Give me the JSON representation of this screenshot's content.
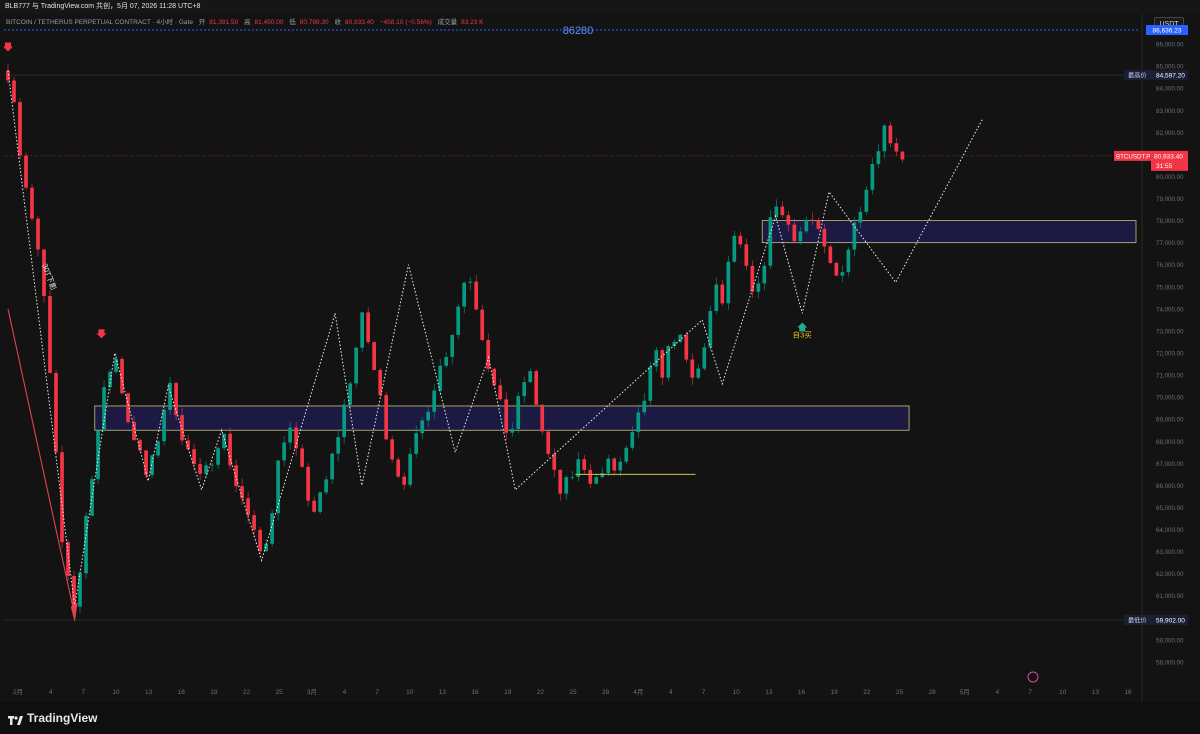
{
  "topbar": {
    "text": "BLB777 与 TradingView.com 共创，5月 07, 2026 11:28 UTC+8"
  },
  "legend": {
    "symbol": "BITCOIN / TETHERUS PERPETUAL CONTRACT · 4小时 · Gate",
    "open_label": "开",
    "open": "81,391.50",
    "high_label": "高",
    "high": "81,450.00",
    "low_label": "低",
    "low": "80,798.30",
    "close_label": "收",
    "close": "80,933.40",
    "change": "−458.10 (−0.56%)",
    "volume_label": "成交量",
    "volume": "83.23 K"
  },
  "currency_button": "USDT",
  "brand": "TradingView",
  "chart_data": {
    "type": "candlestick",
    "symbol": "BTCUSDT.P",
    "timeframe": "4h",
    "ylim": [
      57000,
      87000
    ],
    "y_ticks": [
      58000,
      59000,
      60000,
      61000,
      62000,
      63000,
      64000,
      65000,
      66000,
      67000,
      68000,
      69000,
      70000,
      71000,
      72000,
      73000,
      74000,
      75000,
      76000,
      77000,
      78000,
      79000,
      80000,
      81000,
      82000,
      83000,
      84000,
      85000,
      86000
    ],
    "x_ticks": [
      "2月",
      "4",
      "7",
      "10",
      "13",
      "16",
      "19",
      "22",
      "25",
      "3月",
      "4",
      "7",
      "10",
      "13",
      "16",
      "19",
      "22",
      "25",
      "28",
      "4月",
      "4",
      "7",
      "10",
      "13",
      "16",
      "19",
      "22",
      "25",
      "28",
      "5月",
      "4",
      "7",
      "10",
      "13",
      "16"
    ],
    "price_path": [
      [
        0,
        84800
      ],
      [
        1,
        83500
      ],
      [
        2,
        80500
      ],
      [
        3,
        79000
      ],
      [
        4,
        77000
      ],
      [
        5,
        76000
      ],
      [
        6,
        72000
      ],
      [
        7,
        68000
      ],
      [
        8,
        63500
      ],
      [
        9,
        62000
      ],
      [
        10,
        60500
      ],
      [
        11,
        62500
      ],
      [
        12,
        65500
      ],
      [
        13,
        67500
      ],
      [
        14,
        69500
      ],
      [
        15,
        71000
      ],
      [
        16,
        72000
      ],
      [
        17,
        70500
      ],
      [
        18,
        69000
      ],
      [
        19,
        68200
      ],
      [
        20,
        67000
      ],
      [
        21,
        66200
      ],
      [
        22,
        67500
      ],
      [
        23,
        69000
      ],
      [
        24,
        70500
      ],
      [
        25,
        69800
      ],
      [
        26,
        68500
      ],
      [
        27,
        67500
      ],
      [
        28,
        66800
      ],
      [
        29,
        66000
      ],
      [
        30,
        66800
      ],
      [
        31,
        67800
      ],
      [
        32,
        68500
      ],
      [
        33,
        67500
      ],
      [
        34,
        66200
      ],
      [
        35,
        65500
      ],
      [
        36,
        64500
      ],
      [
        37,
        63500
      ],
      [
        38,
        62800
      ],
      [
        39,
        64000
      ],
      [
        40,
        66000
      ],
      [
        41,
        68000
      ],
      [
        42,
        68800
      ],
      [
        43,
        67500
      ],
      [
        44,
        66500
      ],
      [
        45,
        65500
      ],
      [
        46,
        64800
      ],
      [
        47,
        65500
      ],
      [
        48,
        66500
      ],
      [
        49,
        67800
      ],
      [
        50,
        69000
      ],
      [
        51,
        70500
      ],
      [
        52,
        72000
      ],
      [
        53,
        73500
      ],
      [
        54,
        72500
      ],
      [
        55,
        71000
      ],
      [
        56,
        69500
      ],
      [
        57,
        68000
      ],
      [
        58,
        67000
      ],
      [
        59,
        66200
      ],
      [
        60,
        66800
      ],
      [
        61,
        67800
      ],
      [
        62,
        68800
      ],
      [
        63,
        69800
      ],
      [
        64,
        70800
      ],
      [
        65,
        71500
      ],
      [
        66,
        72500
      ],
      [
        67,
        73500
      ],
      [
        68,
        75000
      ],
      [
        69,
        75800
      ],
      [
        70,
        74500
      ],
      [
        71,
        73000
      ],
      [
        72,
        71500
      ],
      [
        73,
        70200
      ],
      [
        74,
        69200
      ],
      [
        75,
        68200
      ],
      [
        76,
        69000
      ],
      [
        77,
        70500
      ],
      [
        78,
        71200
      ],
      [
        79,
        70000
      ],
      [
        80,
        68500
      ],
      [
        81,
        67200
      ],
      [
        82,
        66200
      ],
      [
        83,
        65500
      ],
      [
        84,
        66200
      ],
      [
        85,
        66800
      ],
      [
        86,
        67200
      ],
      [
        87,
        66500
      ],
      [
        88,
        66200
      ],
      [
        89,
        66600
      ],
      [
        90,
        66900
      ],
      [
        91,
        66700
      ],
      [
        92,
        67100
      ],
      [
        93,
        67600
      ],
      [
        94,
        68500
      ],
      [
        95,
        69500
      ],
      [
        96,
        70800
      ],
      [
        97,
        71800
      ],
      [
        98,
        71200
      ],
      [
        99,
        72100
      ],
      [
        100,
        73000
      ],
      [
        101,
        72200
      ],
      [
        102,
        71000
      ],
      [
        103,
        70600
      ],
      [
        104,
        72000
      ],
      [
        105,
        73500
      ],
      [
        106,
        74800
      ],
      [
        107,
        74300
      ],
      [
        108,
        76000
      ],
      [
        109,
        77600
      ],
      [
        110,
        76200
      ],
      [
        111,
        75200
      ],
      [
        112,
        74000
      ],
      [
        113,
        75800
      ],
      [
        114,
        77500
      ],
      [
        115,
        79000
      ],
      [
        116,
        78200
      ],
      [
        117,
        77800
      ],
      [
        118,
        77400
      ],
      [
        119,
        77600
      ],
      [
        120,
        78300
      ],
      [
        121,
        77500
      ],
      [
        122,
        76800
      ],
      [
        123,
        76000
      ],
      [
        124,
        75400
      ],
      [
        125,
        76000
      ],
      [
        126,
        76900
      ],
      [
        127,
        78000
      ],
      [
        128,
        79200
      ],
      [
        129,
        80200
      ],
      [
        130,
        81100
      ],
      [
        131,
        82300
      ],
      [
        132,
        81900
      ],
      [
        133,
        81400
      ],
      [
        134,
        80933
      ]
    ],
    "horizontal_levels": [
      {
        "label": "86280",
        "value": 86636.23,
        "axis_label": "86,636.23",
        "color": "#2962ff"
      },
      {
        "label": "最高价",
        "value": 84597.2,
        "axis_label": "84,597.20"
      },
      {
        "label": "最低价",
        "value": 59902.0,
        "axis_label": "59,902.00"
      }
    ],
    "current_price": {
      "symbol": "BTCUSDT.P",
      "value": 80933.4,
      "axis_label": "80,933.40",
      "countdown": "31:55"
    },
    "zones": [
      {
        "from_index": 13,
        "to_index": 135,
        "low": 68500,
        "high": 69600
      },
      {
        "from_index": 113,
        "to_index": 169,
        "low": 77000,
        "high": 78000
      }
    ],
    "zigzag": [
      [
        0,
        84800
      ],
      [
        10,
        60500
      ],
      [
        16,
        72000
      ],
      [
        21,
        66200
      ],
      [
        24,
        70500
      ],
      [
        29,
        65800
      ],
      [
        32,
        68500
      ],
      [
        38,
        62600
      ],
      [
        49,
        73800
      ],
      [
        53,
        66000
      ],
      [
        60,
        76000
      ],
      [
        67,
        67500
      ],
      [
        72,
        71800
      ],
      [
        76,
        65800
      ],
      [
        104,
        73500
      ],
      [
        107,
        70600
      ],
      [
        115,
        78200
      ],
      [
        119,
        73800
      ],
      [
        123,
        79300
      ],
      [
        133,
        75200
      ],
      [
        146,
        82600
      ]
    ],
    "annotations": [
      {
        "text": "30T下影",
        "index": 3,
        "value": 76000
      },
      {
        "text": "自3买",
        "index": 119,
        "value": 72700
      }
    ]
  }
}
